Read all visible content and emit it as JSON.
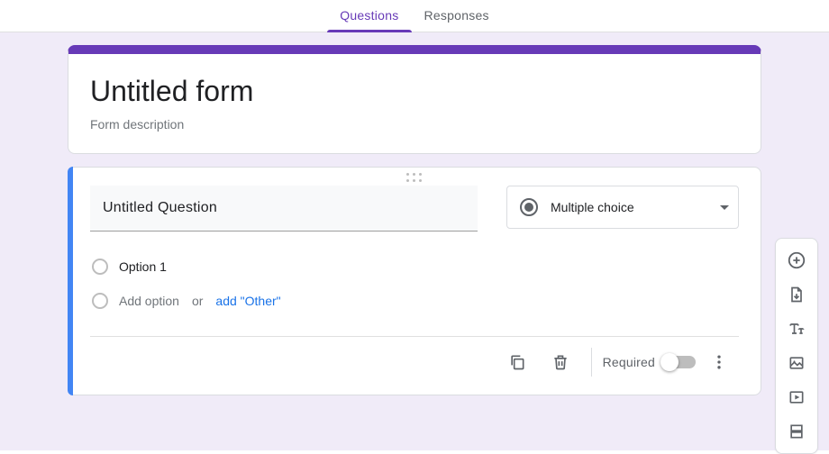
{
  "tabs": {
    "questions": "Questions",
    "responses": "Responses",
    "active": "questions"
  },
  "form": {
    "title": "Untitled form",
    "description": "Form description"
  },
  "question": {
    "title": "Untitled Question",
    "type_label": "Multiple choice",
    "option1": "Option 1",
    "add_option": "Add option",
    "or": "or",
    "add_other": "add \"Other\"",
    "required_label": "Required"
  },
  "toolbar": {
    "add_question": "Add question",
    "import_questions": "Import questions",
    "add_title": "Add title and description",
    "add_image": "Add image",
    "add_video": "Add video",
    "add_section": "Add section"
  }
}
